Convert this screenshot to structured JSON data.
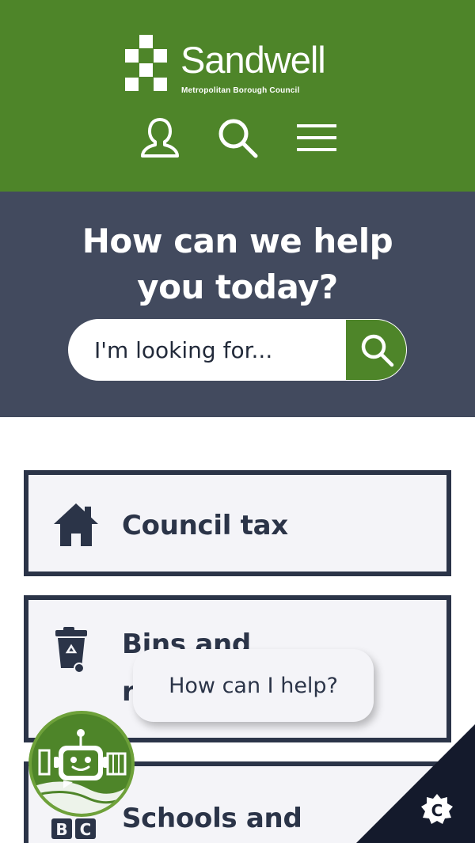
{
  "header": {
    "logo_name": "Sandwell",
    "logo_sub": "Metropolitan Borough Council",
    "account_icon": "user-icon",
    "search_icon": "search-icon",
    "menu_icon": "hamburger-menu-icon",
    "background": "#4e8529"
  },
  "hero": {
    "title_line1": "How can we help",
    "title_line2": "you today?",
    "search_placeholder": "I'm looking for...",
    "search_button_icon": "search-icon",
    "background": "#424a5e"
  },
  "cards": [
    {
      "label": "Council tax",
      "icon": "house-icon"
    },
    {
      "label_line1": "Bins and",
      "label_line2": "r",
      "icon": "wheelie-bin-icon"
    },
    {
      "label": "Schools and",
      "icon": "abc-blocks-icon"
    }
  ],
  "chat": {
    "bubble_text": "How can I help?",
    "bot_icon": "robot-icon"
  },
  "cookie": {
    "icon": "cookie-settings-icon",
    "letter": "C"
  },
  "colors": {
    "brand_green": "#4e8529",
    "dark_navy": "#2b3448",
    "slate": "#424a5e"
  }
}
